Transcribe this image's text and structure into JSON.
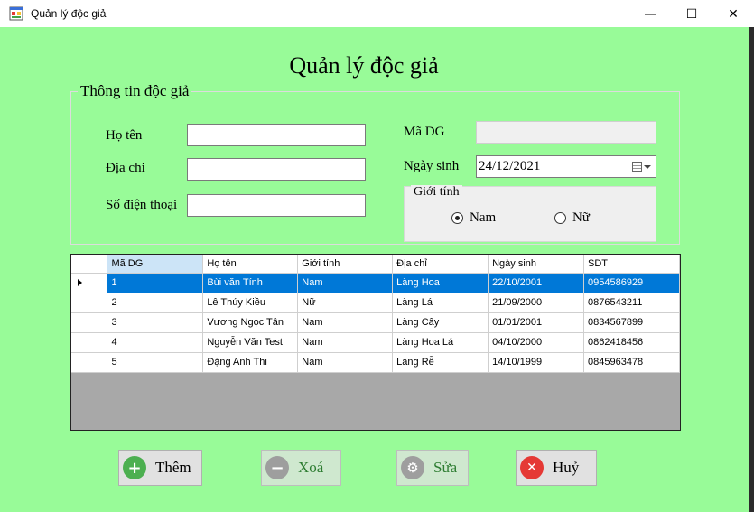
{
  "window": {
    "title": "Quản lý độc giả",
    "minimize_glyph": "—",
    "maximize_glyph": "☐",
    "close_glyph": "✕"
  },
  "heading": "Quản lý độc giả",
  "info_group": {
    "title": "Thông tin độc giả",
    "name_label": "Họ tên",
    "name_value": "",
    "address_label": "Địa chi",
    "address_value": "",
    "phone_label": "Số điện thoại",
    "phone_value": "",
    "id_label": "Mã DG",
    "id_value": "",
    "dob_label": "Ngày sinh",
    "dob_value": "24/12/2021",
    "gender_group": {
      "title": "Giới tính",
      "options": [
        "Nam",
        "Nữ"
      ],
      "selected": "Nam"
    }
  },
  "grid": {
    "columns": [
      "Mã DG",
      "Họ tên",
      "Giới tính",
      "Địa chỉ",
      "Ngày sinh",
      "SDT"
    ],
    "rows": [
      [
        "1",
        "Bùi văn Tính",
        "Nam",
        "Làng Hoa",
        "22/10/2001",
        "0954586929"
      ],
      [
        "2",
        "Lê Thúy Kiều",
        "Nữ",
        "Làng Lá",
        "21/09/2000",
        "0876543211"
      ],
      [
        "3",
        "Vương Ngọc Tân",
        "Nam",
        "Làng Cây",
        "01/01/2001",
        "0834567899"
      ],
      [
        "4",
        "Nguyễn Văn Test",
        "Nam",
        "Làng Hoa Lá",
        "04/10/2000",
        "0862418456"
      ],
      [
        "5",
        "Đặng Anh Thi",
        "Nam",
        "Làng Rễ",
        "14/10/1999",
        "0845963478"
      ]
    ],
    "selected_row": 0
  },
  "buttons": {
    "add": {
      "label": "Thêm",
      "icon": "plus-icon",
      "color": "#4caf50",
      "enabled": true
    },
    "delete": {
      "label": "Xoá",
      "icon": "minus-icon",
      "color": "#9e9e9e",
      "enabled": false
    },
    "edit": {
      "label": "Sửa",
      "icon": "gear-icon",
      "color": "#9e9e9e",
      "enabled": false
    },
    "cancel": {
      "label": "Huỷ",
      "icon": "close-circle-icon",
      "color": "#e53935",
      "enabled": true
    }
  },
  "colors": {
    "form_background": "#98fb98",
    "selection": "#0078d7"
  }
}
